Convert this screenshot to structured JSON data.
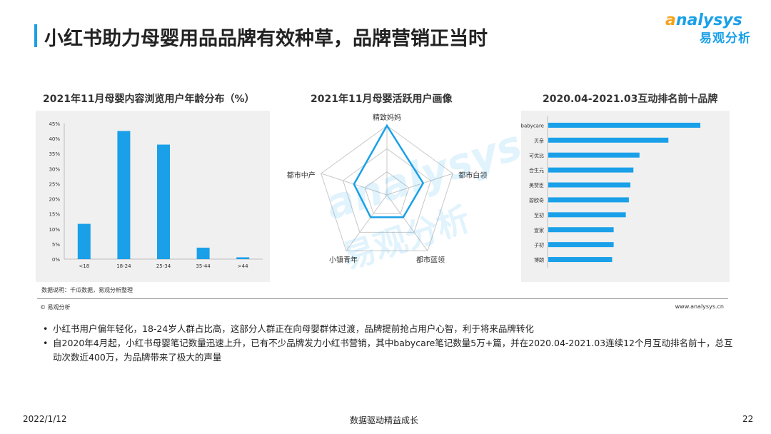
{
  "header": {
    "title": "小红书助力母婴用品品牌有效种草，品牌营销正当时",
    "logo_top_a": "a",
    "logo_top_rest": "nalysys",
    "logo_bottom": "易观分析"
  },
  "watermark": {
    "line1": "analysys",
    "line2": "易观分析"
  },
  "colors": {
    "accent": "#1aa0e8",
    "logo_orange": "#f5a21b",
    "panel_bg": "#f0f0f0"
  },
  "chart_titles": {
    "age": "2021年11月母婴内容浏览用户年龄分布（%）",
    "radar": "2021年11月母婴活跃用户画像",
    "brands": "2020.04-2021.03互动排名前十品牌"
  },
  "chart_data": [
    {
      "type": "bar",
      "title": "2021年11月母婴内容浏览用户年龄分布（%）",
      "categories": [
        "<18",
        "18-24",
        "25-34",
        "35-44",
        ">44"
      ],
      "values": [
        11.7,
        42.5,
        38.0,
        3.8,
        0.6
      ],
      "ylim": [
        0,
        45
      ],
      "yticks": [
        "0%",
        "5%",
        "10%",
        "15%",
        "20%",
        "25%",
        "30%",
        "35%",
        "40%",
        "45%"
      ],
      "grid": false
    },
    {
      "type": "radar",
      "title": "2021年11月母婴活跃用户画像",
      "categories": [
        "精致妈妈",
        "都市白领",
        "都市蓝领",
        "小镇青年",
        "都市中产"
      ],
      "values": [
        1.0,
        0.55,
        0.4,
        0.4,
        0.5
      ],
      "rings": 3
    },
    {
      "type": "bar",
      "orientation": "horizontal",
      "title": "2020.04-2021.03互动排名前十品牌",
      "categories": [
        "babycare",
        "贝亲",
        "可优比",
        "合生元",
        "美赞臣",
        "碧欧奇",
        "至初",
        "宜家",
        "子初",
        "博朗"
      ],
      "values": [
        100,
        79,
        60,
        56,
        54,
        53,
        51,
        43,
        43,
        42
      ]
    }
  ],
  "note": "数据说明：千瓜数据，易观分析整理",
  "copyright": "© 易观分析",
  "url": "www.analysys.cn",
  "bullets": [
    "小红书用户偏年轻化，18-24岁人群占比高，这部分人群正在向母婴群体过渡，品牌提前抢占用户心智，利于将来品牌转化",
    "自2020年4月起，小红书母婴笔记数量迅速上升，已有不少品牌发力小红书营销，其中babycare笔记数量5万+篇，并在2020.04-2021.03连续12个月互动排名前十，总互动次数近400万，为品牌带来了极大的声量"
  ],
  "footer": {
    "date": "2022/1/12",
    "slogan": "数据驱动精益成长",
    "page": "22"
  }
}
